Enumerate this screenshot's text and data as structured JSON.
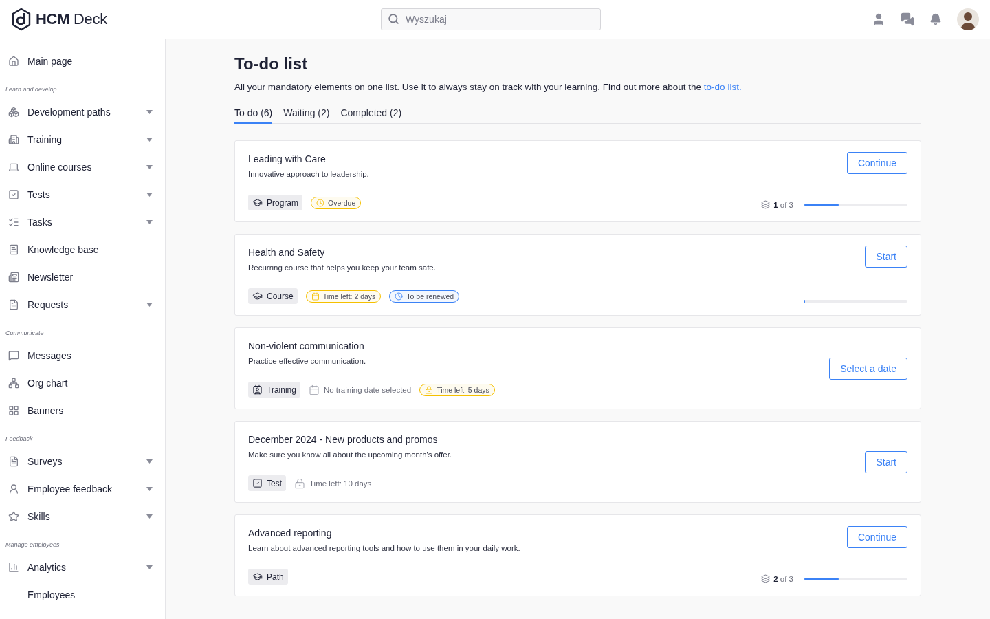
{
  "header": {
    "logo": "HCM Deck",
    "search": {
      "placeholder": "Wyszukaj"
    }
  },
  "sidebar": {
    "sections": [
      {
        "items": [
          {
            "label": "Main page",
            "expandable": false
          }
        ]
      },
      {
        "heading": "Learn and develop",
        "items": [
          {
            "label": "Development paths",
            "expandable": true
          },
          {
            "label": "Training",
            "expandable": true
          },
          {
            "label": "Online courses",
            "expandable": true
          },
          {
            "label": "Tests",
            "expandable": true
          },
          {
            "label": "Tasks",
            "expandable": true
          },
          {
            "label": "Knowledge base",
            "expandable": false
          },
          {
            "label": "Newsletter",
            "expandable": false
          },
          {
            "label": "Requests",
            "expandable": true
          }
        ]
      },
      {
        "heading": "Communicate",
        "items": [
          {
            "label": "Messages",
            "expandable": false
          },
          {
            "label": "Org chart",
            "expandable": false
          },
          {
            "label": "Banners",
            "expandable": false
          }
        ]
      },
      {
        "heading": "Feedback",
        "items": [
          {
            "label": "Surveys",
            "expandable": true
          },
          {
            "label": "Employee feedback",
            "expandable": true
          },
          {
            "label": "Skills",
            "expandable": true
          }
        ]
      },
      {
        "heading": "Manage employees",
        "items": [
          {
            "label": "Analytics",
            "expandable": true
          },
          {
            "label": "Employees",
            "expandable": false
          }
        ]
      }
    ]
  },
  "page": {
    "title": "To-do list",
    "intro": "All your mandatory elements on one list. Use it to always stay on track with your learning. Find out more about the",
    "intro_link": "to-do list.",
    "tabs": [
      {
        "label": "To do (6)",
        "selected": true
      },
      {
        "label": "Waiting (2)",
        "selected": false
      },
      {
        "label": "Completed (2)",
        "selected": false
      }
    ],
    "cards": [
      {
        "title": "Leading with Care",
        "description": "Innovative approach to leadership.",
        "button": "Continue",
        "tags": [
          {
            "kind": "program",
            "label": "Program"
          },
          {
            "kind": "overdue",
            "label": "Overdue",
            "color": "#f5c000"
          }
        ],
        "progress": {
          "reading": "**1** of 3",
          "level": 0.33
        }
      },
      {
        "title": "Health and Safety",
        "description": "Recurring course that helps you keep your team safe.",
        "button": "Start",
        "tags": [
          {
            "kind": "course",
            "label": "Course"
          },
          {
            "kind": "deadline",
            "label": "Time left: 2 days",
            "color": "#f5c000"
          },
          {
            "kind": "renewal",
            "label": "To be renewed",
            "color": "#3b82f6"
          }
        ],
        "progress": {
          "level": 0
        }
      },
      {
        "title": "Non-violent communication",
        "description": "Practice effective communication.",
        "button": "Select a date",
        "tags": [
          {
            "kind": "training",
            "label": "Training"
          },
          {
            "kind": "no-date",
            "label": "No training date selected"
          },
          {
            "kind": "locked-time",
            "label": "Time left: 5 days",
            "color": "#f5c000"
          }
        ]
      },
      {
        "title": "December 2024 - New products and promos",
        "description": "Make sure you know all about the upcoming month's offer.",
        "button": "Start",
        "tags": [
          {
            "kind": "test",
            "label": "Test"
          },
          {
            "kind": "locked-time",
            "label": "Time left: 10 days"
          }
        ]
      },
      {
        "title": "Advanced reporting",
        "description": "Learn about advanced reporting tools and how to use them in your daily work.",
        "button": "Continue",
        "tags": [
          {
            "kind": "path",
            "label": "Path"
          }
        ],
        "progress": {
          "reading": "**2** of 3",
          "level": 0.33
        }
      }
    ]
  }
}
